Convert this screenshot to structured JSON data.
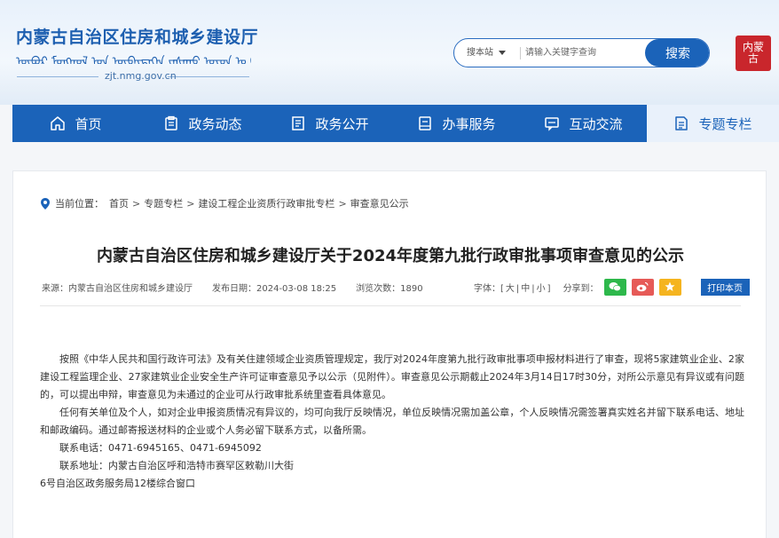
{
  "header": {
    "title": "内蒙古自治区住房和城乡建设厅",
    "mongolian": "ᠥᠪᠥᠷ ᠮᠣᠩᠭᠣᠯ ᠤᠨ ᠥᠪᠡᠷᠲᠡᠭᠡᠨ ᠵᠠᠰᠠᠬᠤ ᠣᠷᠤᠨ ᠤ ᠪᠠᠶᠢᠰᠢᠩ",
    "url": "zjt.nmg.gov.cn",
    "seal_text": "内蒙古"
  },
  "search": {
    "scope": "搜本站",
    "placeholder": "请输入关键字查询",
    "button": "搜索"
  },
  "nav": [
    {
      "label": "首页",
      "icon": "home-icon"
    },
    {
      "label": "政务动态",
      "icon": "clipboard-icon"
    },
    {
      "label": "政务公开",
      "icon": "document-icon"
    },
    {
      "label": "办事服务",
      "icon": "form-icon"
    },
    {
      "label": "互动交流",
      "icon": "chat-icon"
    },
    {
      "label": "专题专栏",
      "icon": "column-icon",
      "active": true
    }
  ],
  "breadcrumb": {
    "prefix": "当前位置：",
    "items": [
      "首页",
      "专题专栏",
      "建设工程企业资质行政审批专栏",
      "审查意见公示"
    ],
    "separator": ">"
  },
  "article": {
    "title": "内蒙古自治区住房和城乡建设厅关于2024年度第九批行政审批事项审查意见的公示",
    "source": "来源：内蒙古自治区住房和城乡建设厅",
    "date": "发布日期：2024-03-08 18:25",
    "views": "浏览次数：1890",
    "font_size_label": "字体：[",
    "font_large": "大",
    "font_medium": "中",
    "font_small": "小",
    "font_size_end": "]",
    "share_label": "分享到：",
    "print": "打印本页",
    "paragraphs": [
      "按照《中华人民共和国行政许可法》及有关住建领域企业资质管理规定，我厅对2024年度第九批行政审批事项申报材料进行了审查，现将5家建筑业企业、2家建设工程监理企业、27家建筑业企业安全生产许可证审查意见予以公示（见附件）。审查意见公示期截止2024年3月14日17时30分，对所公示意见有异议或有问题的，可以提出申辩，审查意见为未通过的企业可从行政审批系统里查看具体意见。",
      "任何有关单位及个人，如对企业申报资质情况有异议的，均可向我厅反映情况，单位反映情况需加盖公章，个人反映情况需签署真实姓名并留下联系电话、地址和邮政编码。通过邮寄报送材料的企业或个人务必留下联系方式，以备所需。",
      "联系电话：0471-6945165、0471-6945092",
      "联系地址：内蒙古自治区呼和浩特市赛罕区敕勒川大街",
      "6号自治区政务服务局12楼综合窗口"
    ]
  },
  "colors": {
    "primary": "#1b63b9",
    "nav_active_bg": "#e9f1fb",
    "wechat": "#2db84b",
    "weibo": "#e65a57",
    "qzone": "#f5b41f"
  }
}
